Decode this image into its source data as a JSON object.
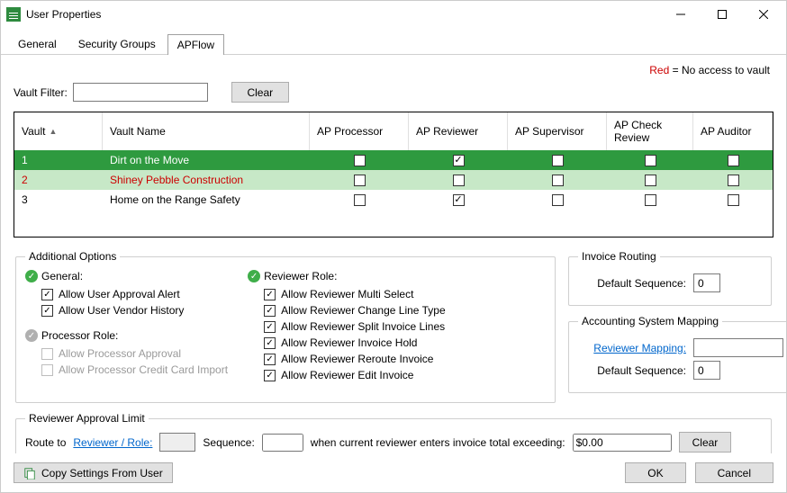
{
  "window": {
    "title": "User Properties"
  },
  "tabs": [
    "General",
    "Security Groups",
    "APFlow"
  ],
  "active_tab": 2,
  "legend": {
    "red_label": "Red",
    "red_suffix": " = No access to vault"
  },
  "filter": {
    "label": "Vault Filter:",
    "value": "",
    "clear": "Clear"
  },
  "grid": {
    "columns": [
      "Vault",
      "Vault Name",
      "AP Processor",
      "AP Reviewer",
      "AP Supervisor",
      "AP Check Review",
      "AP Auditor"
    ],
    "rows": [
      {
        "vault": "1",
        "name": "Dirt on the Move",
        "proc": false,
        "rev": true,
        "sup": false,
        "chk": false,
        "aud": false,
        "no_access": false
      },
      {
        "vault": "2",
        "name": "Shiney Pebble Construction",
        "proc": false,
        "rev": false,
        "sup": false,
        "chk": false,
        "aud": false,
        "no_access": true
      },
      {
        "vault": "3",
        "name": "Home on the Range Safety",
        "proc": false,
        "rev": true,
        "sup": false,
        "chk": false,
        "aud": false,
        "no_access": false
      }
    ]
  },
  "addl": {
    "legend": "Additional Options",
    "general": {
      "title": "General:",
      "opts": [
        {
          "label": "Allow User Approval Alert",
          "checked": true,
          "enabled": true
        },
        {
          "label": "Allow User Vendor History",
          "checked": true,
          "enabled": true
        }
      ]
    },
    "processor": {
      "title": "Processor Role:",
      "opts": [
        {
          "label": "Allow Processor Approval",
          "checked": false,
          "enabled": false
        },
        {
          "label": "Allow Processor Credit Card Import",
          "checked": false,
          "enabled": false
        }
      ]
    },
    "reviewer": {
      "title": "Reviewer Role:",
      "opts": [
        {
          "label": "Allow Reviewer Multi Select",
          "checked": true,
          "enabled": true
        },
        {
          "label": "Allow Reviewer Change Line Type",
          "checked": true,
          "enabled": true
        },
        {
          "label": "Allow Reviewer Split Invoice Lines",
          "checked": true,
          "enabled": true
        },
        {
          "label": "Allow Reviewer Invoice Hold",
          "checked": true,
          "enabled": true
        },
        {
          "label": "Allow Reviewer Reroute Invoice",
          "checked": true,
          "enabled": true
        },
        {
          "label": "Allow Reviewer Edit Invoice",
          "checked": true,
          "enabled": true
        }
      ]
    }
  },
  "routing": {
    "legend": "Invoice Routing",
    "seq_label": "Default Sequence:",
    "seq_value": "0"
  },
  "mapping": {
    "legend": "Accounting System Mapping",
    "link_label": "Reviewer Mapping:",
    "link_value": "",
    "seq_label": "Default Sequence:",
    "seq_value": "0"
  },
  "approval": {
    "legend": "Reviewer Approval Limit",
    "route_to": "Route to",
    "link": "Reviewer / Role:",
    "seq": "Sequence:",
    "tail": "when current reviewer enters invoice total exceeding:",
    "amount": "$0.00",
    "clear": "Clear"
  },
  "footer": {
    "copy": "Copy Settings From User",
    "ok": "OK",
    "cancel": "Cancel"
  }
}
